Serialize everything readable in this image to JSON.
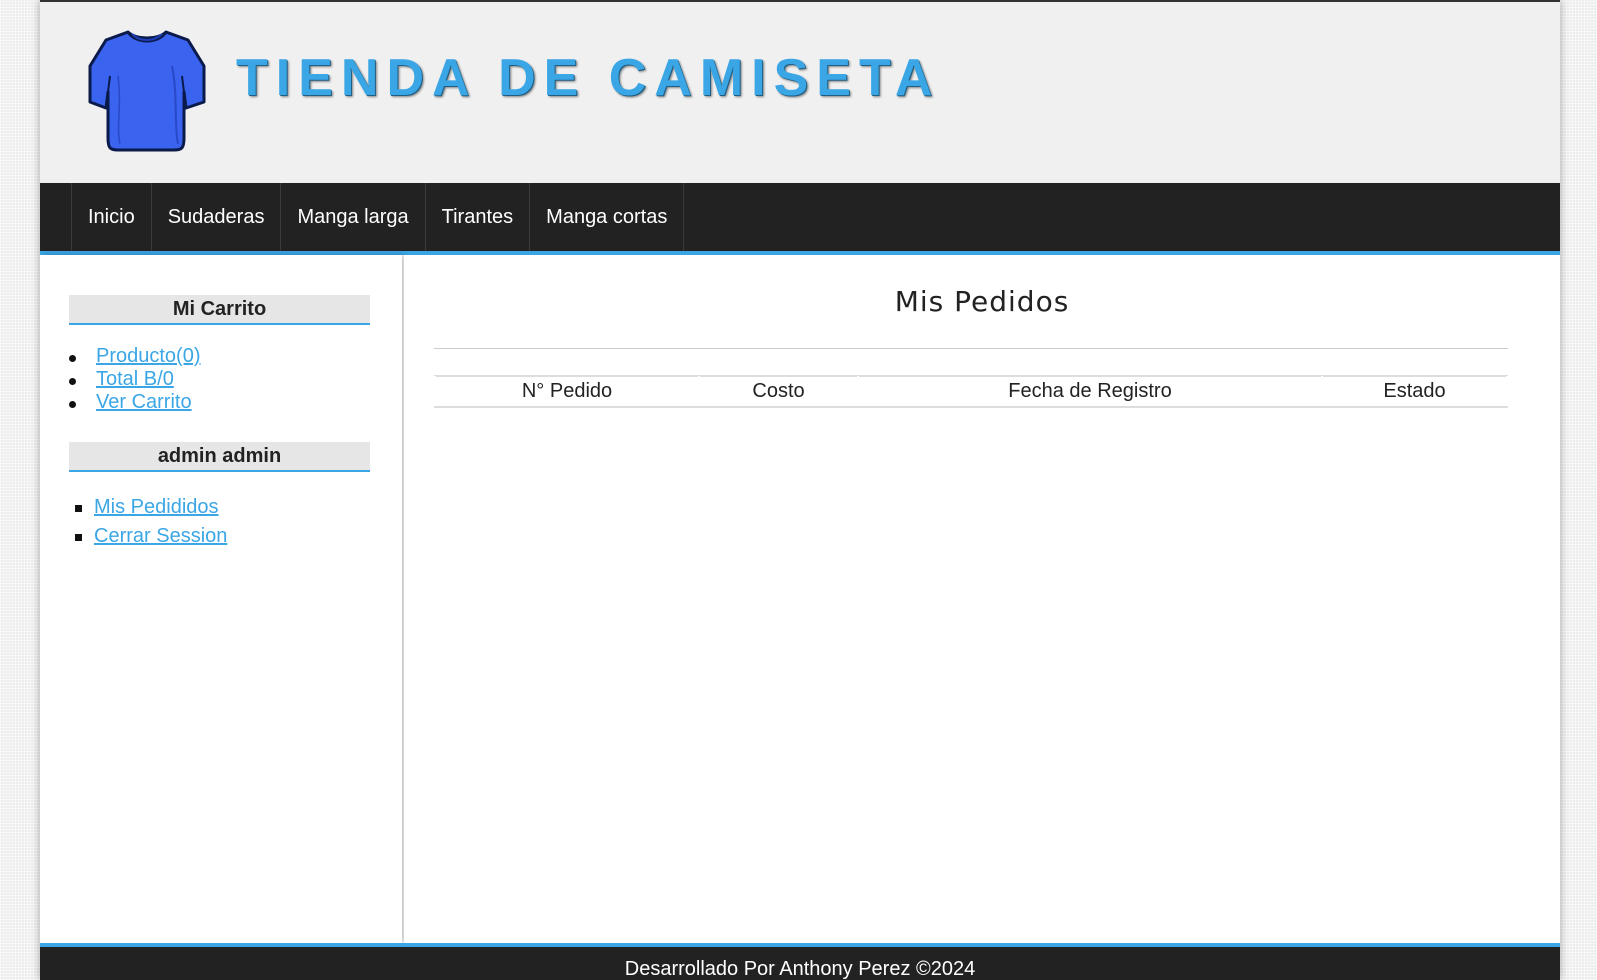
{
  "header": {
    "title": "TIENDA DE CAMISETA",
    "logo_icon": "tshirt-icon",
    "title_color": "#3aa6e6"
  },
  "nav": {
    "items": [
      {
        "label": "Inicio"
      },
      {
        "label": "Sudaderas"
      },
      {
        "label": "Manga larga"
      },
      {
        "label": "Tirantes"
      },
      {
        "label": "Manga cortas"
      }
    ]
  },
  "sidebar": {
    "cart": {
      "heading": "Mi Carrito",
      "links": [
        "Producto(0)",
        "Total B/0",
        "Ver Carrito"
      ]
    },
    "user": {
      "heading": "admin admin",
      "links": [
        "Mis Pedididos",
        "Cerrar Session"
      ]
    }
  },
  "main": {
    "title": "Mis Pedidos",
    "table": {
      "columns": [
        "N° Pedido",
        "Costo",
        "Fecha de Registro",
        "Estado"
      ],
      "rows": []
    }
  },
  "footer": {
    "text": "Desarrollado Por Anthony Perez ©2024"
  },
  "colors": {
    "accent": "#3aa6e6",
    "nav_background": "#222222",
    "header_background": "#f0f0f0",
    "tshirt_blue": "#3a63f0"
  }
}
